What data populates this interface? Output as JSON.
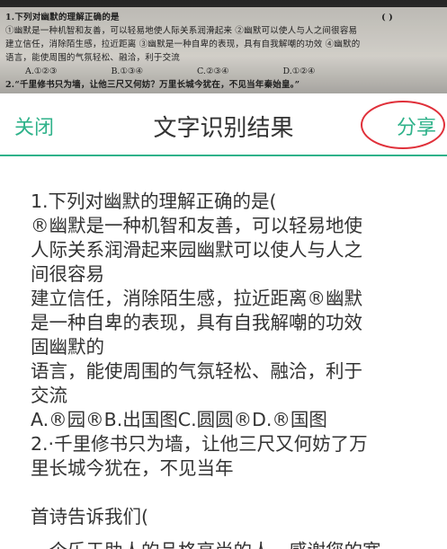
{
  "photo": {
    "lines": [
      "1.下列对幽默的理解正确的是",
      "①幽默是一种机智和友善，可以轻易地使人际关系润滑起来 ②幽默可以使人与人之间很容易",
      "建立信任，消除陌生感，拉近距离 ③幽默是一种自卑的表现，具有自我解嘲的功效 ④幽默的",
      "语言，能使周围的气氛轻松、融洽，利于交流"
    ],
    "paren": "(     )",
    "options": [
      "A.①②③",
      "B.①③④",
      "C.②③④",
      "D.①②④"
    ],
    "cut_line": "2.“千里修书只为墙，让他三尺又何妨？万里长城今犹在，不见当年秦始皇。”"
  },
  "header": {
    "close_label": "关闭",
    "title": "文字识别结果",
    "share_label": "分享"
  },
  "result_lines": [
    "1.下列对幽默的理解正确的是(",
    "®幽默是一种机智和友善，可以轻易地使",
    "人际关系润滑起来园幽默可以使人与人之",
    "间很容易",
    "建立信任，消除陌生感，拉近距离®幽默",
    "是一种自卑的表现，具有自我解嘲的功效",
    "固幽默的",
    "语言，能使周围的气氛轻松、融洽，利于",
    "交流",
    "A.®园®B.出国图C.圆圆®D.®国图",
    "2.·千里修书只为墙，让他三尺又何妨了万",
    "里长城今犹在，不见当年"
  ],
  "result_after_gap": "首诗告诉我们(",
  "result_cut": "一个乐于助人的品格高尚的人。感谢您的宽容"
}
